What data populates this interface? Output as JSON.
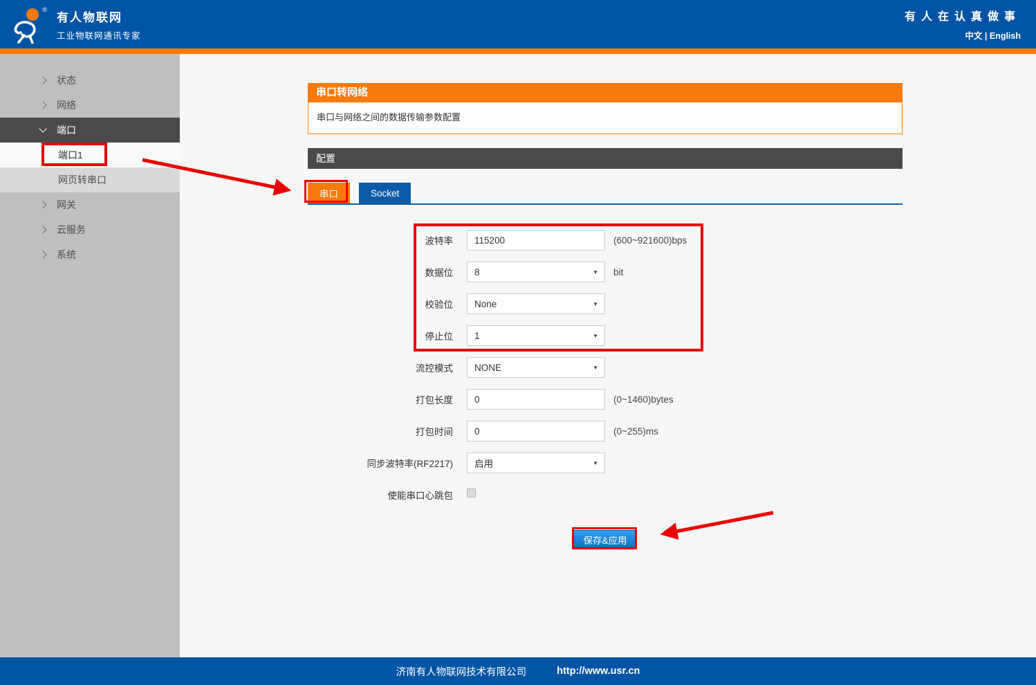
{
  "header": {
    "brand_title": "有人物联网",
    "brand_subtitle": "工业物联网通讯专家",
    "slogan": "有人在认真做事",
    "lang_zh": "中文",
    "lang_divider": "|",
    "lang_en": "English"
  },
  "sidebar": {
    "items": [
      {
        "label": "状态",
        "chevron": "right"
      },
      {
        "label": "网络",
        "chevron": "right"
      },
      {
        "label": "端口",
        "chevron": "down",
        "active": true
      },
      {
        "label": "端口1",
        "sub": true,
        "selected": true
      },
      {
        "label": "网页转串口",
        "sub": true
      },
      {
        "label": "网关",
        "chevron": "right"
      },
      {
        "label": "云服务",
        "chevron": "right"
      },
      {
        "label": "系统",
        "chevron": "right"
      }
    ]
  },
  "main": {
    "page_header": {
      "title": "串口转网络",
      "description": "串口与网络之间的数据传输参数配置"
    },
    "section_title": "配置",
    "tabs": [
      {
        "label": "串口",
        "active": true
      },
      {
        "label": "Socket",
        "active": false
      }
    ],
    "form": {
      "fields": [
        {
          "name": "baud-rate",
          "label": "波特率",
          "type": "input",
          "value": "115200",
          "hint": "(600~921600)bps"
        },
        {
          "name": "data-bits",
          "label": "数据位",
          "type": "select",
          "value": "8",
          "hint": "bit"
        },
        {
          "name": "parity",
          "label": "校验位",
          "type": "select",
          "value": "None",
          "hint": ""
        },
        {
          "name": "stop-bits",
          "label": "停止位",
          "type": "select",
          "value": "1",
          "hint": ""
        },
        {
          "name": "flow-control",
          "label": "流控模式",
          "type": "select",
          "value": "NONE",
          "hint": ""
        },
        {
          "name": "packing-length",
          "label": "打包长度",
          "type": "input",
          "value": "0",
          "hint": "(0~1460)bytes"
        },
        {
          "name": "packing-time",
          "label": "打包时间",
          "type": "input",
          "value": "0",
          "hint": "(0~255)ms"
        },
        {
          "name": "sync-baudrate",
          "label": "同步波特率(RF2217)",
          "type": "select",
          "value": "启用",
          "hint": ""
        },
        {
          "name": "heartbeat-enable",
          "label": "使能串口心跳包",
          "type": "checkbox",
          "checked": false,
          "hint": ""
        }
      ],
      "save_button": "保存&应用"
    }
  },
  "footer": {
    "company": "济南有人物联网技术有限公司",
    "url": "http://www.usr.cn"
  },
  "colors": {
    "header_blue": "#0054a6",
    "accent_orange": "#f87a0a",
    "section_gray": "#4a4a4a",
    "tab_blue": "#0d5ba8",
    "save_button_blue": "#0c70c2",
    "annotation_red": "#e80000"
  },
  "annotations": {
    "highlighted_elements": [
      "端口1",
      "串口",
      "串口参数四项",
      "保存&应用"
    ]
  }
}
